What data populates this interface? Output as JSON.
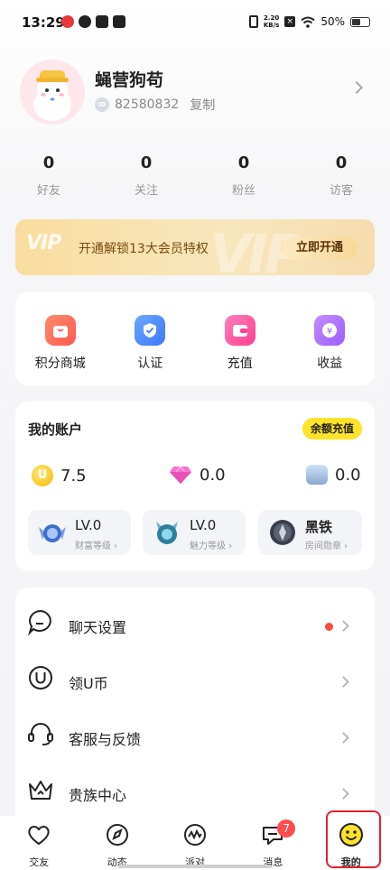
{
  "status_bar": {
    "time": "13:29",
    "network_speed_value": "2.20",
    "network_speed_unit": "KB/s",
    "battery_text": "50%"
  },
  "profile": {
    "username": "蝇营狗苟",
    "id_badge": "ID",
    "id": "82580832",
    "copy_label": "复制"
  },
  "stats": [
    {
      "value": "0",
      "label": "好友"
    },
    {
      "value": "0",
      "label": "关注"
    },
    {
      "value": "0",
      "label": "粉丝"
    },
    {
      "value": "0",
      "label": "访客"
    }
  ],
  "vip": {
    "logo": "VIP",
    "text": "开通解锁13大会员特权",
    "watermark": "VIP",
    "button": "立即开通"
  },
  "quick_actions": [
    {
      "label": "积分商城",
      "icon": "shop-bag-icon",
      "color": "#ff6a5c"
    },
    {
      "label": "认证",
      "icon": "shield-check-icon",
      "color": "#4d8bff"
    },
    {
      "label": "充值",
      "icon": "wallet-icon",
      "color": "#ff5fa8"
    },
    {
      "label": "收益",
      "icon": "yuan-coin-icon",
      "color": "#b06cff"
    }
  ],
  "account": {
    "title": "我的账户",
    "recharge_button": "余额充值",
    "coin_symbol": "U",
    "balances": [
      "7.5",
      "0.0",
      "0.0"
    ],
    "levels": [
      {
        "value": "LV.0",
        "label": "财富等级"
      },
      {
        "value": "LV.0",
        "label": "魅力等级"
      },
      {
        "value": "黑铁",
        "label": "房间勋章"
      }
    ]
  },
  "settings": [
    {
      "label": "聊天设置",
      "icon": "chat-bubble-icon",
      "has_dot": true
    },
    {
      "label": "领U币",
      "icon": "u-coin-icon",
      "has_dot": false
    },
    {
      "label": "客服与反馈",
      "icon": "headset-icon",
      "has_dot": false
    },
    {
      "label": "贵族中心",
      "icon": "crown-icon",
      "has_dot": false
    }
  ],
  "bottom_nav": [
    {
      "label": "交友",
      "icon": "heart-icon"
    },
    {
      "label": "动态",
      "icon": "compass-icon"
    },
    {
      "label": "派对",
      "icon": "party-wave-icon"
    },
    {
      "label": "消息",
      "icon": "message-icon",
      "badge": "7"
    },
    {
      "label": "我的",
      "icon": "smiley-icon",
      "active": true
    }
  ],
  "colors": {
    "accent_yellow": "#ffe328",
    "highlight_red": "#e2222b",
    "badge_red": "#ff4d4f"
  }
}
